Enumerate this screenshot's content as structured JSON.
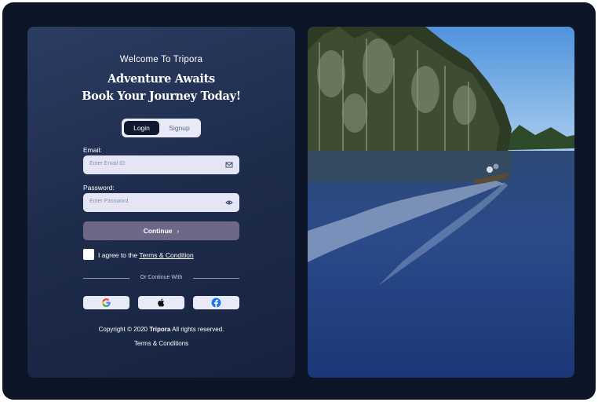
{
  "welcome": "Welcome To Tripora",
  "headline": {
    "line1": "Adventure Awaits",
    "line2": "Book Your Journey Today!"
  },
  "toggle": {
    "login": "Login",
    "signup": "Signup"
  },
  "email": {
    "label": "Email:",
    "placeholder": "Enter Email ID"
  },
  "password": {
    "label": "Password:",
    "placeholder": "Enter Password"
  },
  "continue_label": "Continue",
  "agree": {
    "text": "I agree to the",
    "link": "Terms & Condition"
  },
  "divider_text": "Or Continue With",
  "social": [
    "google-icon",
    "apple-icon",
    "facebook-icon"
  ],
  "footer": {
    "copyright_prefix": "Copyright © 2020",
    "brand": "Tripora",
    "copyright_suffix": "All rights reserved.",
    "terms": "Terms & Conditions"
  },
  "colors": {
    "frame": "#0c1527",
    "panel": "#1f2d4d",
    "button": "#6d6888",
    "input": "#e4e6f6",
    "facebook": "#1877f2"
  }
}
